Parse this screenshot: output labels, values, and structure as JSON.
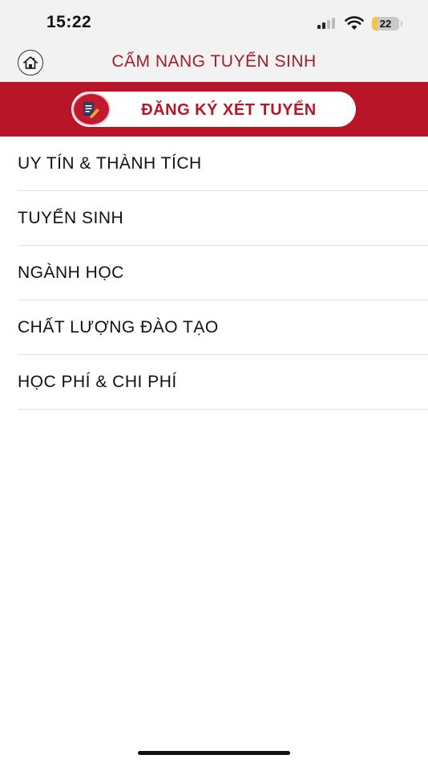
{
  "status_bar": {
    "time": "15:22",
    "battery_level": "22",
    "battery_color": "#f6c343",
    "icons": [
      "signal-icon",
      "wifi-icon",
      "battery-charging-icon"
    ]
  },
  "header": {
    "title": "CẨM NANG TUYỂN SINH",
    "home_icon": "home-icon",
    "title_color": "#a01c2c"
  },
  "banner": {
    "button_label": "ĐĂNG KÝ XÉT TUYỂN",
    "button_icon": "form-pencil-icon",
    "background_color": "#b81529"
  },
  "menu": {
    "items": [
      {
        "label": "UY TÍN & THÀNH TÍCH"
      },
      {
        "label": "TUYỂN SINH"
      },
      {
        "label": "NGÀNH HỌC"
      },
      {
        "label": "CHẤT LƯỢNG ĐÀO TẠO"
      },
      {
        "label": "HỌC PHÍ & CHI PHÍ"
      }
    ]
  }
}
